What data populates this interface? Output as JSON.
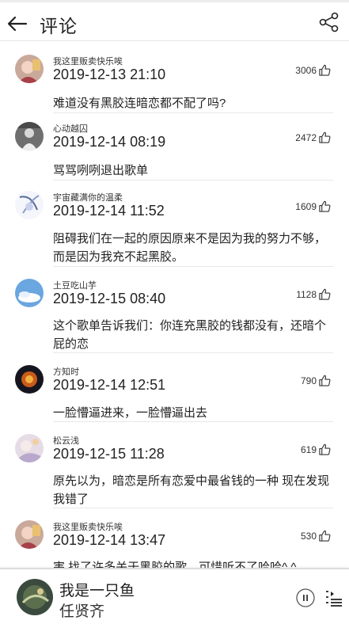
{
  "header": {
    "title": "评论"
  },
  "icons": {
    "back": "back-arrow-icon",
    "share": "share-icon",
    "like": "thumbs-up-icon",
    "pause": "pause-icon",
    "playlist": "playlist-icon"
  },
  "colors": {
    "text": "#222222",
    "divider": "#e8e8e8"
  },
  "comments": [
    {
      "user": "我这里贩卖快乐唉",
      "time": "2019-12-13 21:10",
      "likes": "3006",
      "text": "难道没有黑胶连暗恋都不配了吗?"
    },
    {
      "user": "心动越囚",
      "time": "2019-12-14 08:19",
      "likes": "2472",
      "text": "骂骂咧咧退出歌单"
    },
    {
      "user": "宇宙藏满你的温柔",
      "time": "2019-12-14 11:52",
      "likes": "1609",
      "text": "阻碍我们在一起的原因原来不是因为我的努力不够，而是因为我充不起黑胶。"
    },
    {
      "user": "土豆吃山芋",
      "time": "2019-12-15 08:40",
      "likes": "1128",
      "text": "这个歌单告诉我们：你连充黑胶的钱都没有，还暗个屁的恋"
    },
    {
      "user": "方知时",
      "time": "2019-12-14 12:51",
      "likes": "790",
      "text": "一脸懵逼进来，一脸懵逼出去"
    },
    {
      "user": "松云浅",
      "time": "2019-12-15 11:28",
      "likes": "619",
      "text": "原先以为，暗恋是所有恋爱中最省钱的一种 现在发现我错了"
    },
    {
      "user": "我这里贩卖快乐唉",
      "time": "2019-12-14 13:47",
      "likes": "530",
      "text": "害 找了许多关于黑胶的歌，可惜听不了哈哈^ ^"
    }
  ],
  "player": {
    "song": "我是一只鱼",
    "artist": "任贤齐"
  }
}
